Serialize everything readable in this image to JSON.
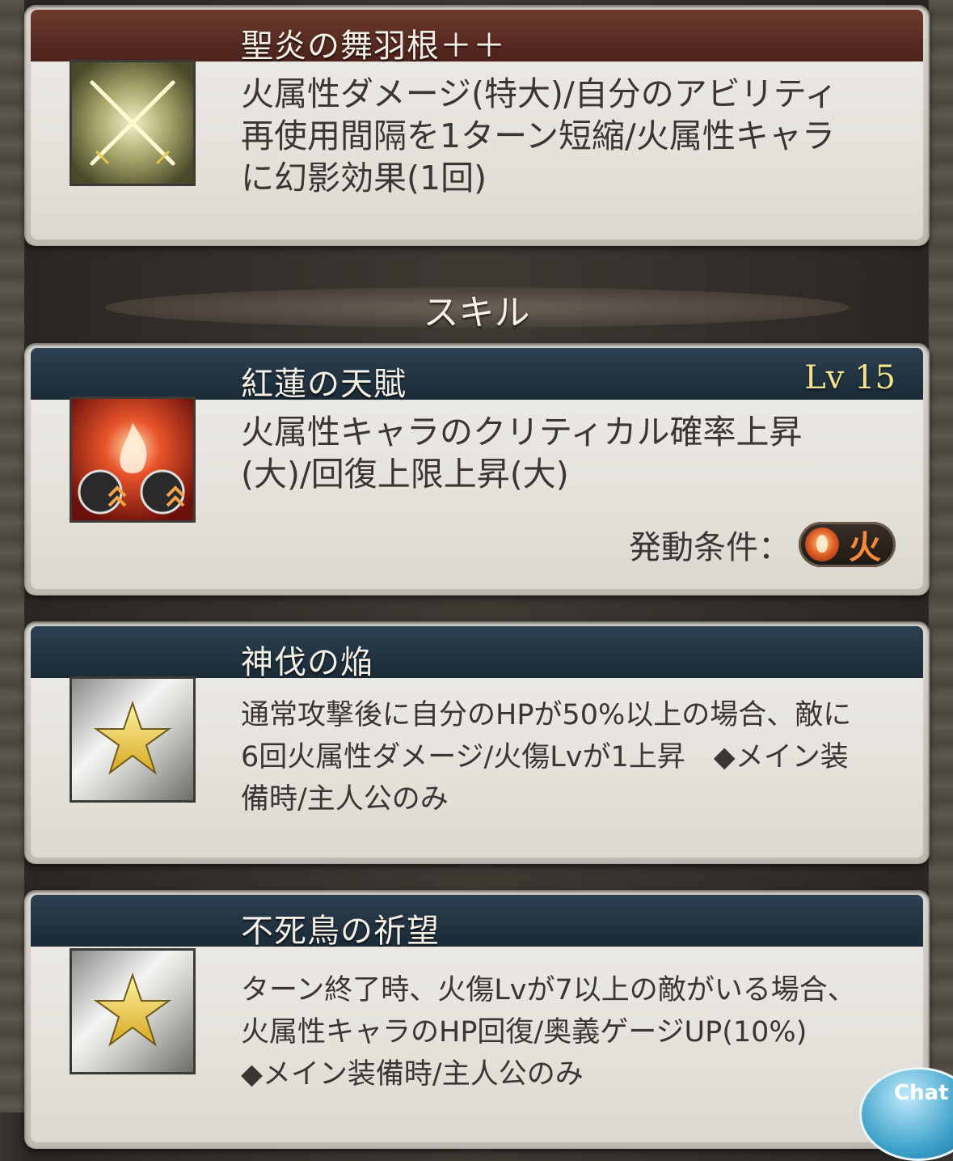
{
  "ability": {
    "title": "聖炎の舞羽根＋＋",
    "desc_lines": [
      "火属性ダメージ(特大)/自分のアビリティ",
      "再使用間隔を1ターン短縮/火属性キャラ",
      "に幻影効果(1回)"
    ],
    "icon": "crossed-swords-icon"
  },
  "section": {
    "title": "スキル"
  },
  "skills": [
    {
      "title": "紅蓮の天賦",
      "level": "Lv 15",
      "desc_lines": [
        "火属性キャラのクリティカル確率上昇",
        "(大)/回復上限上昇(大)"
      ],
      "condition_label": "発動条件：",
      "condition_value": "火",
      "icon": "fire-crit-icon"
    },
    {
      "title": "神伐の焔",
      "desc_lines": [
        "通常攻撃後に自分のHPが50%以上の場合、敵に",
        "6回火属性ダメージ/火傷Lvが1上昇　◆メイン装",
        "備時/主人公のみ"
      ],
      "icon": "star-icon"
    },
    {
      "title": "不死鳥の祈望",
      "desc_lines": [
        "ターン終了時、火傷Lvが7以上の敵がいる場合、",
        "火属性キャラのHP回復/奥義ゲージUP(10%)",
        "◆メイン装備時/主人公のみ"
      ],
      "icon": "star-icon"
    }
  ],
  "chat_button": "Chat",
  "colors": {
    "brown_header": "#5a2c22",
    "navy_header": "#22364a",
    "level_text": "#f2e38a",
    "fire_text": "#f58a3a"
  }
}
